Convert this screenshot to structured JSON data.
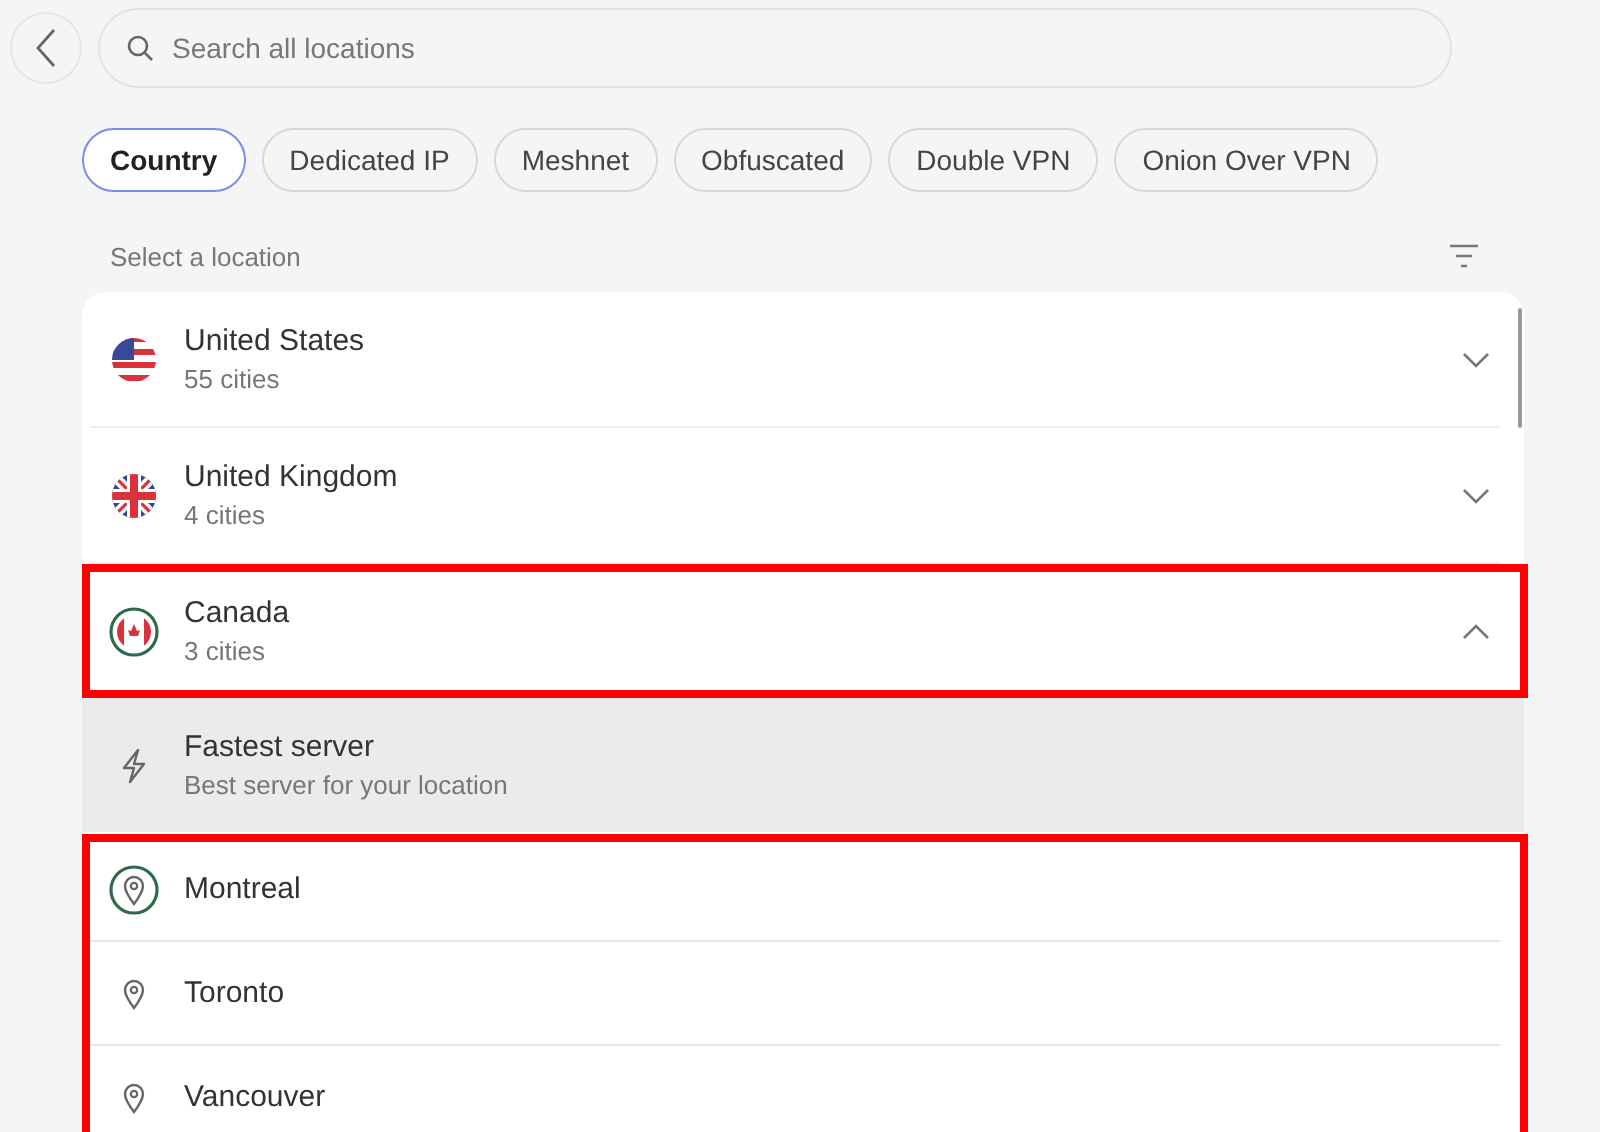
{
  "search": {
    "placeholder": "Search all locations"
  },
  "tabs": [
    {
      "label": "Country",
      "selected": true
    },
    {
      "label": "Dedicated IP",
      "selected": false
    },
    {
      "label": "Meshnet",
      "selected": false
    },
    {
      "label": "Obfuscated",
      "selected": false
    },
    {
      "label": "Double VPN",
      "selected": false
    },
    {
      "label": "Onion Over VPN",
      "selected": false
    }
  ],
  "section_label": "Select a location",
  "countries": [
    {
      "name": "United States",
      "cities_count": "55 cities",
      "expanded": false,
      "selected": false,
      "highlighted": false
    },
    {
      "name": "United Kingdom",
      "cities_count": "4 cities",
      "expanded": false,
      "selected": false,
      "highlighted": false
    },
    {
      "name": "Canada",
      "cities_count": "3 cities",
      "expanded": true,
      "selected": true,
      "highlighted": true,
      "fastest": {
        "title": "Fastest server",
        "subtitle": "Best server for your location"
      },
      "cities_highlighted": true,
      "cities": [
        {
          "name": "Montreal",
          "selected": true
        },
        {
          "name": "Toronto",
          "selected": false
        },
        {
          "name": "Vancouver",
          "selected": false
        }
      ]
    }
  ]
}
